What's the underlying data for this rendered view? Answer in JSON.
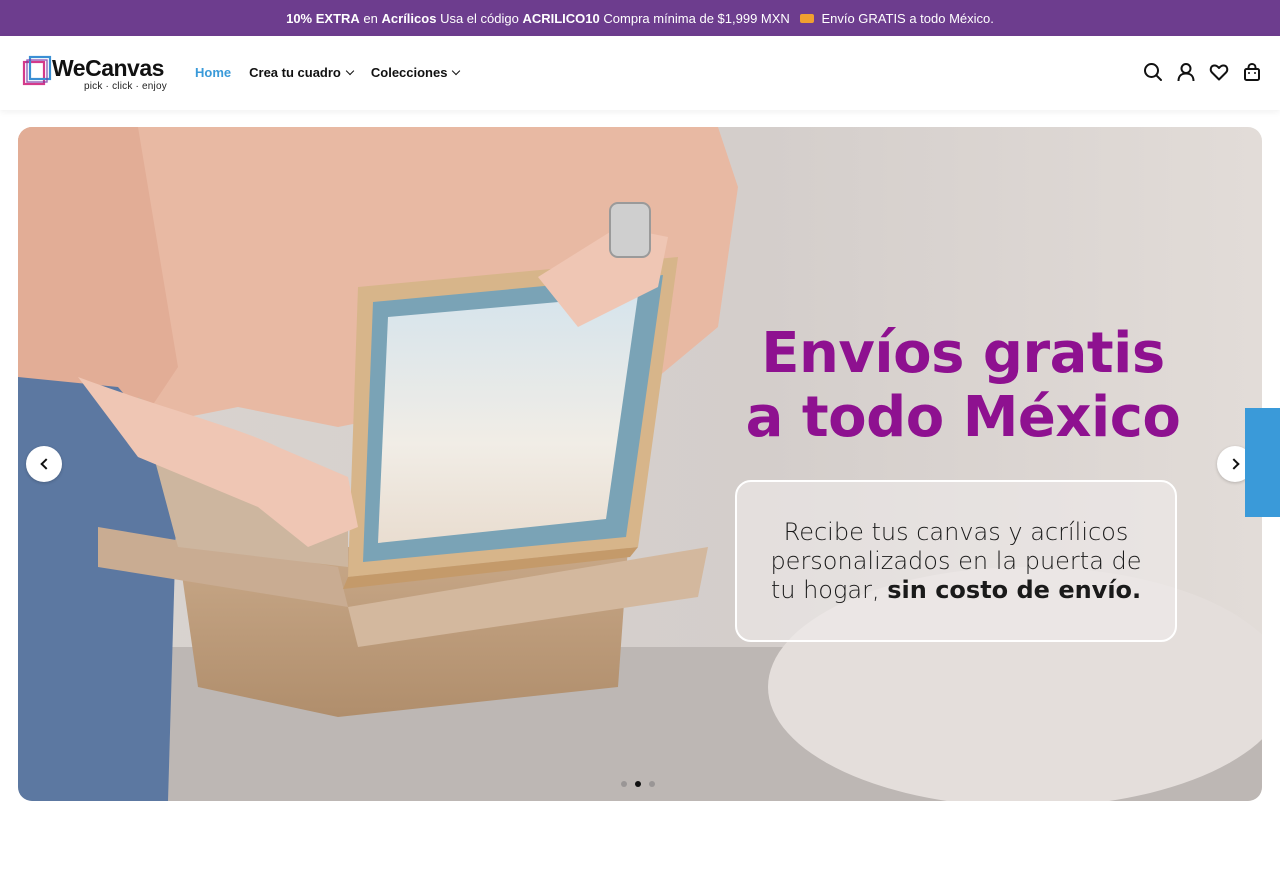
{
  "promo": {
    "part1_bold": "10% EXTRA",
    "part1_text": "en",
    "part1_bold2": "Acrílicos",
    "part2_text": "Usa el código",
    "code": "ACRILICO10",
    "part3_text": "Compra mínima de $1,999 MXN",
    "shipping_text": "Envío GRATIS a todo México.",
    "background_color": "#6d3d8e"
  },
  "header": {
    "logo_word": "WeCanvas",
    "logo_tagline": "pick · click · enjoy",
    "nav": [
      {
        "label": "Home",
        "active": true
      },
      {
        "label": "Crea tu cuadro",
        "has_dropdown": true
      },
      {
        "label": "Colecciones",
        "has_dropdown": true
      }
    ],
    "icons": [
      "search-icon",
      "account-icon",
      "wishlist-icon",
      "cart-icon"
    ],
    "accent_color": "#3a9ad9"
  },
  "hero": {
    "title_line1": "Envíos gratis",
    "title_line2": "a todo México",
    "title_color": "#8e1190",
    "box_text": "Recibe tus canvas y acrílicos personalizados en la puerta de tu hogar,",
    "box_bold": "sin costo de envío.",
    "slides_count": 3,
    "active_slide": 2
  }
}
